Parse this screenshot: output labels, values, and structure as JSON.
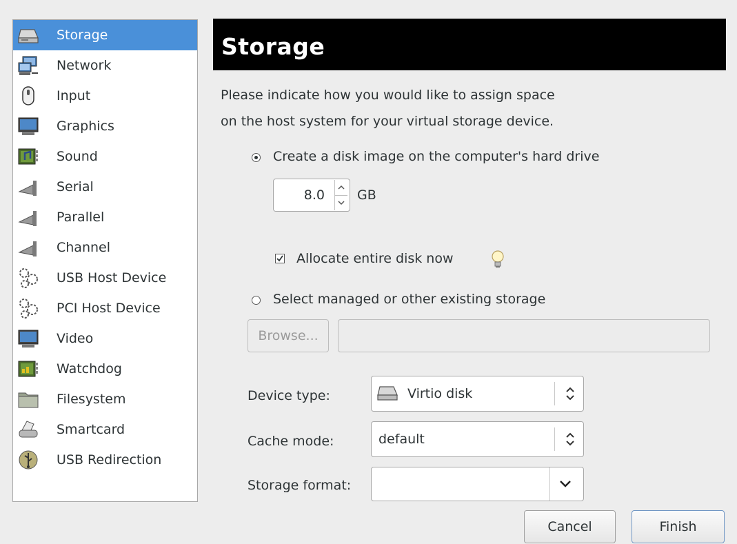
{
  "sidebar": {
    "items": [
      {
        "label": "Storage",
        "icon": "hard-disk-icon",
        "selected": true
      },
      {
        "label": "Network",
        "icon": "network-icon"
      },
      {
        "label": "Input",
        "icon": "mouse-icon"
      },
      {
        "label": "Graphics",
        "icon": "monitor-icon"
      },
      {
        "label": "Sound",
        "icon": "sound-card-icon"
      },
      {
        "label": "Serial",
        "icon": "serial-plug-icon"
      },
      {
        "label": "Parallel",
        "icon": "parallel-plug-icon"
      },
      {
        "label": "Channel",
        "icon": "channel-plug-icon"
      },
      {
        "label": "USB Host Device",
        "icon": "gears-icon"
      },
      {
        "label": "PCI Host Device",
        "icon": "gears-icon"
      },
      {
        "label": "Video",
        "icon": "monitor-icon"
      },
      {
        "label": "Watchdog",
        "icon": "watchdog-card-icon"
      },
      {
        "label": "Filesystem",
        "icon": "folder-icon"
      },
      {
        "label": "Smartcard",
        "icon": "smartcard-reader-icon"
      },
      {
        "label": "USB Redirection",
        "icon": "usb-icon"
      }
    ]
  },
  "header": {
    "title": "Storage"
  },
  "description": {
    "line1": "Please indicate how you would like to assign space",
    "line2": "on the host system for your virtual storage device."
  },
  "options": {
    "create_label": "Create a disk image on the computer's hard drive",
    "create_selected": true,
    "size_value": "8.0",
    "size_unit": "GB",
    "allocate_label": "Allocate entire disk now",
    "allocate_checked": true,
    "select_label": "Select managed or other existing storage",
    "browse_label": "Browse...",
    "path_value": ""
  },
  "form": {
    "device_type_label": "Device type:",
    "device_type_value": "Virtio disk",
    "cache_mode_label": "Cache mode:",
    "cache_mode_value": "default",
    "storage_format_label": "Storage format:",
    "storage_format_value": ""
  },
  "buttons": {
    "cancel": "Cancel",
    "finish": "Finish"
  },
  "colors": {
    "selection": "#4a90d9",
    "header_bg": "#000000",
    "window_bg": "#ededed"
  }
}
